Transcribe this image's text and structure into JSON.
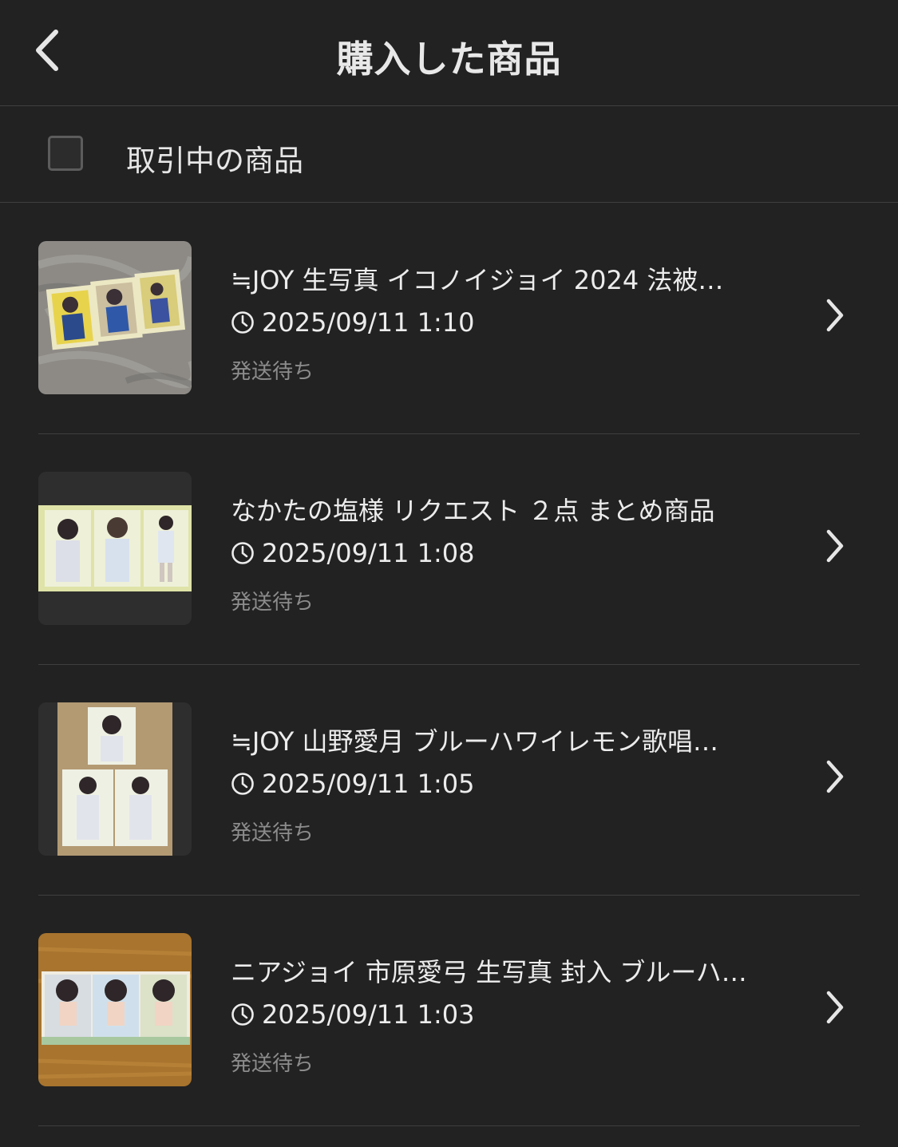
{
  "header": {
    "title": "購入した商品",
    "back_icon": "chevron-left-icon"
  },
  "filter": {
    "label": "取引中の商品",
    "checked": false
  },
  "items": [
    {
      "title": "≒JOY 生写真 イコノイジョイ 2024 法被…",
      "date": "2025/09/11 1:10",
      "status": "発送待ち"
    },
    {
      "title": "なかたの塩様 リクエスト ２点 まとめ商品",
      "date": "2025/09/11 1:08",
      "status": "発送待ち"
    },
    {
      "title": "≒JOY 山野愛月 ブルーハワイレモン歌唱…",
      "date": "2025/09/11 1:05",
      "status": "発送待ち"
    },
    {
      "title": "ニアジョイ 市原愛弓 生写真 封入 ブルーハ…",
      "date": "2025/09/11 1:03",
      "status": "発送待ち"
    }
  ],
  "colors": {
    "background": "#222222",
    "divider": "#3f3f3f",
    "text": "#ececec",
    "muted": "#8c8c8c"
  }
}
